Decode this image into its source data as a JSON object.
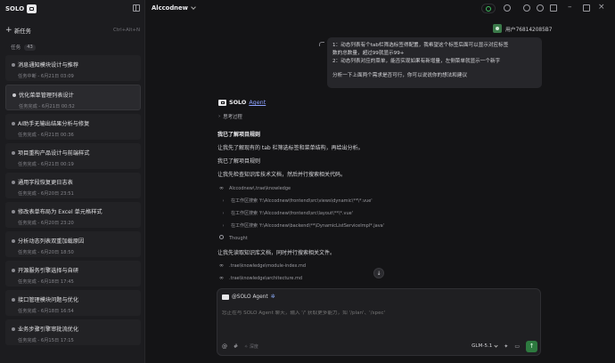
{
  "sidebar": {
    "logo_text": "SOLO",
    "new_task_label": "新任务",
    "new_task_shortcut": "Ctrl+Alt+N",
    "tasks_label": "任务",
    "tasks_count": "43",
    "tasks": [
      {
        "title": "消息通知模块设计与推荐",
        "status": "任务中断 - 6月21日 03:09"
      },
      {
        "title": "优化菜单管理列表设计",
        "status": "任务完成 - 6月21日 00:52"
      },
      {
        "title": "AI助手无输出结果分析与修复",
        "status": "任务完成 - 6月21日 00:36"
      },
      {
        "title": "项目重构产品设计与前端样式",
        "status": "任务完成 - 6月21日 00:19"
      },
      {
        "title": "通用字段恢复更日志表",
        "status": "任务完成 - 6月20日 23:51"
      },
      {
        "title": "修改表单布局为 Excel 单元格样式",
        "status": "任务完成 - 6月20日 23:20"
      },
      {
        "title": "分析动态列表双重加载原因",
        "status": "任务完成 - 6月20日 18:50"
      },
      {
        "title": "开源服务引擎选择与自研",
        "status": "任务完成 - 6月18日 17:45"
      },
      {
        "title": "接口管理模块问题与优化",
        "status": "任务完成 - 6月18日 16:54"
      },
      {
        "title": "业务步骤引擎审批流优化",
        "status": "任务完成 - 6月15日 17:15"
      }
    ]
  },
  "topbar": {
    "project": "Alccodnew"
  },
  "chat": {
    "user_name": "用户768142085B7",
    "user_message": [
      "1：动态列表有个tab栏筛选标签得配置，我希望这个标签后面可以显示对应标签",
      "数的总数量，超过99就显示99+",
      "2：动态列表对应的菜单，能否实现如果有新增量，左侧菜单就显示一个新字",
      "",
      "分析一下上面两个需求是否可行，你可以说说你的想法和建议"
    ],
    "agent_name": "SOLO",
    "agent_suffix": "Agent",
    "thinking_label": "思考过程",
    "lines": {
      "rules_title": "我已了解项目规则",
      "intro": "让我先了解现有的 tab 栏筛选标签和菜单结构，再给出分析。",
      "rules_repeat": "我已了解项目规则",
      "check": "让我先检查知识库技术文档，然后并行搜索相关代码。",
      "read": "让我先读取知识库文档，同时并行搜索相关文件。"
    },
    "tools": {
      "kb_path": "Alccodnew\\.trae\\knowledge",
      "search1": "在工作区搜索 'f:\\Alccodnew\\frontend\\src\\views\\dynamic\\**\\*.vue'",
      "search2": "在工作区搜索 'f:\\Alccodnew\\frontend\\src\\layout\\**\\*.vue'",
      "search3": "在工作区搜索 'f:\\Alccodnew\\backend\\**\\DynamicListServiceImpl*.java'",
      "thought": "Thought",
      "file1": ".trae\\knowledge\\module-index.md",
      "file2": ".trae\\knowledge\\architecture.md"
    }
  },
  "composer": {
    "mention": "@SOLO Agent",
    "placeholder": "您正在与 SOLO Agent 聊天，输入 '/' 获取更多能力，如 '/plan'、'/spec'",
    "option_label": "深度",
    "model": "GLM-5.1"
  }
}
